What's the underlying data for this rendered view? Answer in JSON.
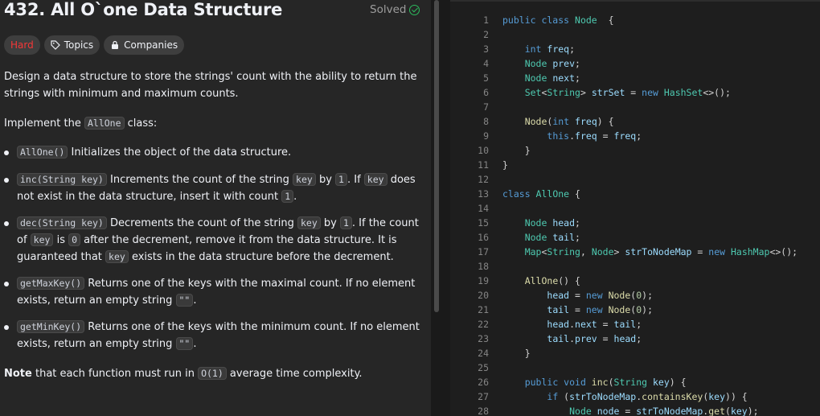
{
  "problem": {
    "title": "432. All O`one Data Structure",
    "status": "Solved",
    "tags": {
      "difficulty": "Hard",
      "topics": "Topics",
      "companies": "Companies"
    }
  },
  "description": {
    "p1_line1": "Design a data structure to store the strings' count with the ability to return the",
    "p1_line2": "strings with minimum and maximum counts.",
    "p2_pre": "Implement the ",
    "p2_code": "AllOne",
    "p2_post": " class:",
    "b1_code": "AllOne()",
    "b1_text": " Initializes the object of the data structure.",
    "b2_code": "inc(String key)",
    "b2_t1": " Increments the count of the string ",
    "b2_c2": "key",
    "b2_t2": " by ",
    "b2_c3": "1",
    "b2_t3": ". If ",
    "b2_c4": "key",
    "b2_t4": " does",
    "b2_l2_pre": "not exist in the data structure, insert it with count ",
    "b2_l2_code": "1",
    "b2_l2_post": ".",
    "b3_code": "dec(String key)",
    "b3_t1": " Decrements the count of the string ",
    "b3_c2": "key",
    "b3_t2": " by ",
    "b3_c3": "1",
    "b3_t3": ". If the count",
    "b3_l2_pre": "of ",
    "b3_l2_c1": "key",
    "b3_l2_t1": " is ",
    "b3_l2_c2": "0",
    "b3_l2_t2": " after the decrement, remove it from the data structure. It is",
    "b3_l3_pre": "guaranteed that ",
    "b3_l3_code": "key",
    "b3_l3_post": " exists in the data structure before the decrement.",
    "b4_code": "getMaxKey()",
    "b4_text": " Returns one of the keys with the maximal count. If no element",
    "b4_l2_pre": "exists, return an empty string ",
    "b4_l2_code": "\"\"",
    "b4_l2_post": ".",
    "b5_code": "getMinKey()",
    "b5_text": " Returns one of the keys with the minimum count. If no element",
    "b5_l2_pre": "exists, return an empty string ",
    "b5_l2_code": "\"\"",
    "b5_l2_post": ".",
    "note_bold": "Note",
    "note_pre": " that each function must run in ",
    "note_code": "O(1)",
    "note_post": " average time complexity."
  },
  "editor": {
    "lines": [
      [
        [
          "kw",
          "public class "
        ],
        [
          "ty",
          "Node"
        ],
        [
          "",
          "  {"
        ]
      ],
      [],
      [
        [
          "",
          "    "
        ],
        [
          "kw",
          "int "
        ],
        [
          "var",
          "freq"
        ],
        [
          "",
          ";"
        ]
      ],
      [
        [
          "",
          "    "
        ],
        [
          "ty",
          "Node "
        ],
        [
          "var",
          "prev"
        ],
        [
          "",
          ";"
        ]
      ],
      [
        [
          "",
          "    "
        ],
        [
          "ty",
          "Node "
        ],
        [
          "var",
          "next"
        ],
        [
          "",
          ";"
        ]
      ],
      [
        [
          "",
          "    "
        ],
        [
          "ty",
          "Set"
        ],
        [
          "",
          "<"
        ],
        [
          "ty",
          "String"
        ],
        [
          "",
          "> "
        ],
        [
          "var",
          "strSet"
        ],
        [
          "",
          " = "
        ],
        [
          "kw",
          "new "
        ],
        [
          "ty",
          "HashSet"
        ],
        [
          "",
          "<>();"
        ]
      ],
      [],
      [
        [
          "",
          "    "
        ],
        [
          "fn",
          "Node"
        ],
        [
          "",
          "("
        ],
        [
          "kw",
          "int "
        ],
        [
          "var",
          "freq"
        ],
        [
          "",
          ") {"
        ]
      ],
      [
        [
          "",
          "        "
        ],
        [
          "kw",
          "this"
        ],
        [
          "",
          "."
        ],
        [
          "var",
          "freq"
        ],
        [
          "",
          " = "
        ],
        [
          "var",
          "freq"
        ],
        [
          "",
          ";"
        ]
      ],
      [
        [
          "",
          "    }"
        ]
      ],
      [
        [
          "",
          "}"
        ]
      ],
      [],
      [
        [
          "kw",
          "class "
        ],
        [
          "ty",
          "AllOne"
        ],
        [
          "",
          " {"
        ]
      ],
      [],
      [
        [
          "",
          "    "
        ],
        [
          "ty",
          "Node "
        ],
        [
          "var",
          "head"
        ],
        [
          "",
          ";"
        ]
      ],
      [
        [
          "",
          "    "
        ],
        [
          "ty",
          "Node "
        ],
        [
          "var",
          "tail"
        ],
        [
          "",
          ";"
        ]
      ],
      [
        [
          "",
          "    "
        ],
        [
          "ty",
          "Map"
        ],
        [
          "",
          "<"
        ],
        [
          "ty",
          "String"
        ],
        [
          "",
          ", "
        ],
        [
          "ty",
          "Node"
        ],
        [
          "",
          "> "
        ],
        [
          "var",
          "strToNodeMap"
        ],
        [
          "",
          " = "
        ],
        [
          "kw",
          "new "
        ],
        [
          "ty",
          "HashMap"
        ],
        [
          "",
          "<>();"
        ]
      ],
      [],
      [
        [
          "",
          "    "
        ],
        [
          "fn",
          "AllOne"
        ],
        [
          "",
          "() {"
        ]
      ],
      [
        [
          "",
          "        "
        ],
        [
          "var",
          "head"
        ],
        [
          "",
          " = "
        ],
        [
          "kw",
          "new "
        ],
        [
          "fn",
          "Node"
        ],
        [
          "",
          "("
        ],
        [
          "num",
          "0"
        ],
        [
          "",
          ");"
        ]
      ],
      [
        [
          "",
          "        "
        ],
        [
          "var",
          "tail"
        ],
        [
          "",
          " = "
        ],
        [
          "kw",
          "new "
        ],
        [
          "fn",
          "Node"
        ],
        [
          "",
          "("
        ],
        [
          "num",
          "0"
        ],
        [
          "",
          ");"
        ]
      ],
      [
        [
          "",
          "        "
        ],
        [
          "var",
          "head"
        ],
        [
          "",
          "."
        ],
        [
          "var",
          "next"
        ],
        [
          "",
          " = "
        ],
        [
          "var",
          "tail"
        ],
        [
          "",
          ";"
        ]
      ],
      [
        [
          "",
          "        "
        ],
        [
          "var",
          "tail"
        ],
        [
          "",
          "."
        ],
        [
          "var",
          "prev"
        ],
        [
          "",
          " = "
        ],
        [
          "var",
          "head"
        ],
        [
          "",
          ";"
        ]
      ],
      [
        [
          "",
          "    }"
        ]
      ],
      [],
      [
        [
          "",
          "    "
        ],
        [
          "kw",
          "public void "
        ],
        [
          "fn",
          "inc"
        ],
        [
          "",
          "("
        ],
        [
          "ty",
          "String "
        ],
        [
          "var",
          "key"
        ],
        [
          "",
          ") {"
        ]
      ],
      [
        [
          "",
          "        "
        ],
        [
          "kw",
          "if "
        ],
        [
          "",
          "("
        ],
        [
          "var",
          "strToNodeMap"
        ],
        [
          "",
          "."
        ],
        [
          "fn",
          "containsKey"
        ],
        [
          "",
          "("
        ],
        [
          "var",
          "key"
        ],
        [
          "",
          ")) {"
        ]
      ],
      [
        [
          "",
          "            "
        ],
        [
          "ty",
          "Node "
        ],
        [
          "var",
          "node"
        ],
        [
          "",
          " = "
        ],
        [
          "var",
          "strToNodeMap"
        ],
        [
          "",
          "."
        ],
        [
          "fn",
          "get"
        ],
        [
          "",
          "("
        ],
        [
          "var",
          "key"
        ],
        [
          "",
          ");"
        ]
      ]
    ]
  },
  "colors": {
    "accent_green": "#2cbb5d",
    "hard_red": "#f63737"
  }
}
